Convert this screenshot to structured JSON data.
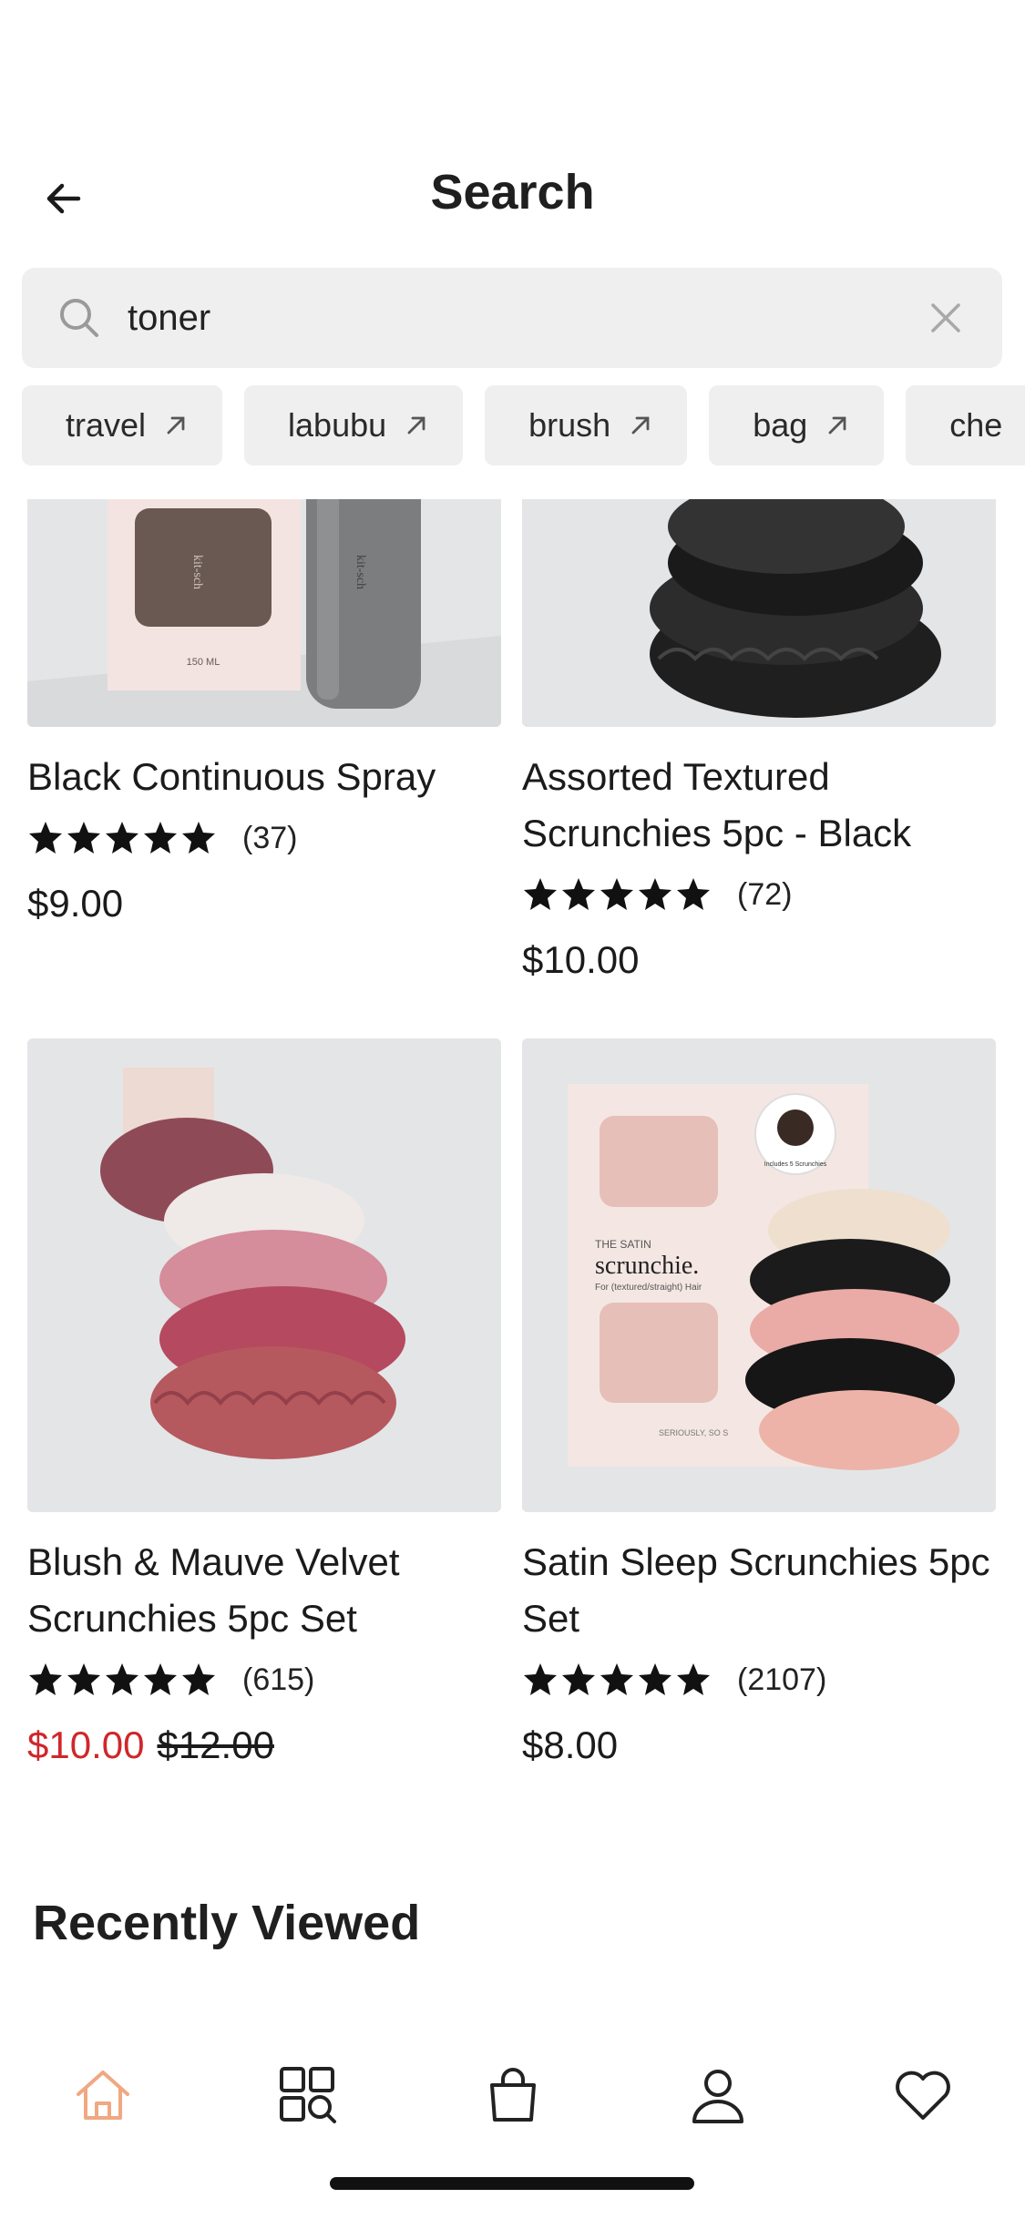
{
  "header": {
    "title": "Search"
  },
  "search": {
    "value": "toner",
    "placeholder": ""
  },
  "chips": [
    "travel",
    "labubu",
    "brush",
    "bag",
    "che"
  ],
  "products": [
    {
      "name": "Black Continuous Spray",
      "rating": 5,
      "reviews": "(37)",
      "price": "$9.00",
      "image": "black-spray-bottle-box"
    },
    {
      "name": "Assorted Textured Scrunchies 5pc - Black",
      "rating": 5,
      "reviews": "(72)",
      "price": "$10.00",
      "image": "black-scrunchies-stack"
    },
    {
      "name": "Blush & Mauve Velvet Scrunchies 5pc Set",
      "rating": 5,
      "reviews": "(615)",
      "sale_price": "$10.00",
      "original_price": "$12.00",
      "image": "velvet-scrunchies-stack"
    },
    {
      "name": "Satin Sleep Scrunchies 5pc Set",
      "rating": 5,
      "reviews": "(2107)",
      "price": "$8.00",
      "image": "satin-scrunchies-box",
      "box_text": {
        "line1": "THE SATIN",
        "line2": "scrunchie.",
        "line3": "For (textured/straight) Hair",
        "line4": "SERIOUSLY, SO S"
      },
      "sticker_text": "Includes 5 Scrunchies"
    }
  ],
  "spray_box": {
    "brand": "kit-sch",
    "volume": "150 ML"
  },
  "recently_viewed": {
    "title": "Recently Viewed"
  },
  "tabbar": {
    "items": [
      "home-icon",
      "browse-search-icon",
      "bag-icon",
      "account-icon",
      "heart-icon"
    ],
    "active": "home-icon"
  },
  "colors": {
    "sale": "#d0262a",
    "accent": "#f0a882",
    "surface": "#efefef",
    "image_bg": "#e5e6e8"
  }
}
